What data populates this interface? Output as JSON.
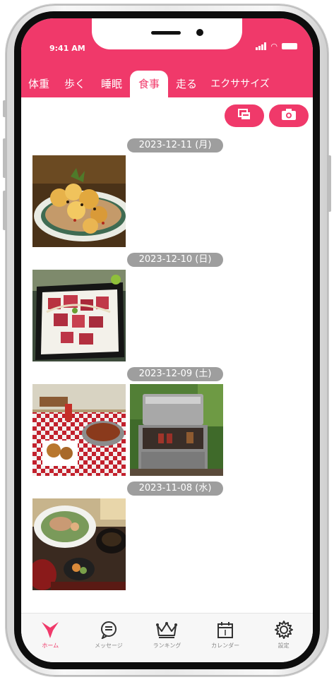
{
  "status_bar": {
    "time": "9:41 AM"
  },
  "tabs": [
    {
      "label": "体重",
      "active": false
    },
    {
      "label": "歩く",
      "active": false
    },
    {
      "label": "睡眠",
      "active": false
    },
    {
      "label": "食事",
      "active": true
    },
    {
      "label": "走る",
      "active": false
    },
    {
      "label": "エクササイズ",
      "active": false
    }
  ],
  "actions": {
    "gallery_icon": "gallery-icon",
    "camera_icon": "camera-icon"
  },
  "meals": [
    {
      "date": "2023-12-11 (月)",
      "photos": [
        "grilled-skewers-plate"
      ]
    },
    {
      "date": "2023-12-10 (日)",
      "photos": [
        "tuna-poke-bowl"
      ]
    },
    {
      "date": "2023-12-09 (土)",
      "photos": [
        "picnic-table-food",
        "bbq-grill"
      ]
    },
    {
      "date": "2023-11-08 (水)",
      "photos": [
        "japanese-set-meal"
      ]
    }
  ],
  "tabbar": [
    {
      "label": "ホーム",
      "icon": "home-icon",
      "active": true
    },
    {
      "label": "メッセージ",
      "icon": "message-icon",
      "active": false
    },
    {
      "label": "ランキング",
      "icon": "crown-icon",
      "active": false
    },
    {
      "label": "カレンダー",
      "icon": "calendar-icon",
      "active": false
    },
    {
      "label": "設定",
      "icon": "gear-icon",
      "active": false
    }
  ],
  "colors": {
    "accent": "#f0396a",
    "pill": "#9e9e9e"
  }
}
